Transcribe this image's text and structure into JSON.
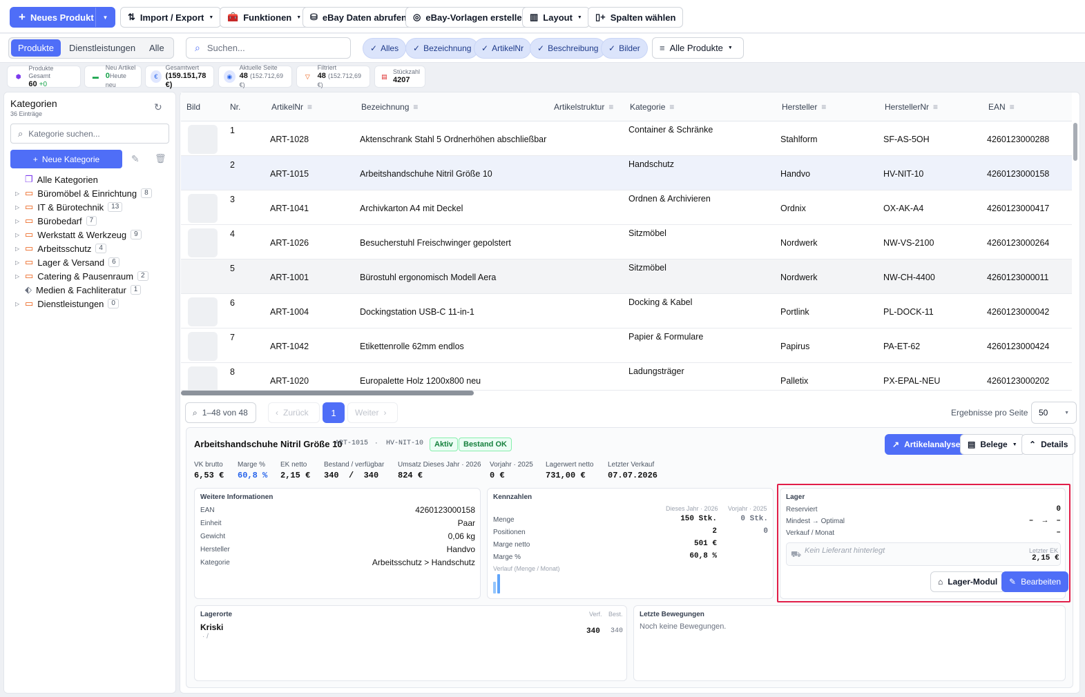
{
  "toolbar": {
    "new_product": "Neues Produkt",
    "import_export": "Import / Export",
    "functions": "Funktionen",
    "ebay_fetch": "eBay Daten abrufen",
    "ebay_templates": "eBay-Vorlagen erstellen",
    "layout": "Layout",
    "columns": "Spalten wählen"
  },
  "tabs": [
    "Produkte",
    "Dienstleistungen",
    "Alle"
  ],
  "search": {
    "placeholder": "Suchen..."
  },
  "filters": [
    "Alles",
    "Bezeichnung",
    "ArtikelNr",
    "Beschreibung",
    "Bilder"
  ],
  "product_filter": "Alle Produkte",
  "stats": [
    {
      "label": "Produkte Gesamt",
      "value": "60",
      "extra": "+0"
    },
    {
      "label": "Neu Artikel",
      "value": "0",
      "extra": "Heute neu"
    },
    {
      "label": "Gesamtwert",
      "value": "(159.151,78 €)",
      "extra": ""
    },
    {
      "label": "Aktuelle Seite",
      "value": "48",
      "extra": "(152.712,69 €)"
    },
    {
      "label": "Filtriert",
      "value": "48",
      "extra": "(152.712,69 €)"
    },
    {
      "label": "Stückzahl",
      "value": "4207",
      "extra": ""
    }
  ],
  "sidebar": {
    "title": "Kategorien",
    "subtitle": "36 Einträge",
    "search_placeholder": "Kategorie suchen...",
    "new_category": "Neue Kategorie",
    "all": "Alle Kategorien",
    "items": [
      {
        "label": "Büromöbel & Einrichtung",
        "count": "8"
      },
      {
        "label": "IT & Bürotechnik",
        "count": "13"
      },
      {
        "label": "Bürobedarf",
        "count": "7"
      },
      {
        "label": "Werkstatt & Werkzeug",
        "count": "9"
      },
      {
        "label": "Arbeitsschutz",
        "count": "4"
      },
      {
        "label": "Lager & Versand",
        "count": "6"
      },
      {
        "label": "Catering & Pausenraum",
        "count": "2"
      },
      {
        "label": "Medien & Fachliteratur",
        "count": "1"
      },
      {
        "label": "Dienstleistungen",
        "count": "0"
      }
    ]
  },
  "table": {
    "headers": [
      "Bild",
      "Nr.",
      "ArtikelNr",
      "Bezeichnung",
      "Artikelstruktur",
      "Kategorie",
      "Hersteller",
      "HerstellerNr",
      "EAN"
    ],
    "rows": [
      {
        "nr": "1",
        "art": "ART-1028",
        "bez": "Aktenschrank Stahl 5 Ordnerhöhen abschließbar",
        "kat": "Container & Schränke",
        "her": "Stahlform",
        "hnr": "SF-AS-5OH",
        "ean": "4260123000288"
      },
      {
        "nr": "2",
        "art": "ART-1015",
        "bez": "Arbeitshandschuhe Nitril Größe 10",
        "kat": "Handschutz",
        "her": "Handvo",
        "hnr": "HV-NIT-10",
        "ean": "4260123000158"
      },
      {
        "nr": "3",
        "art": "ART-1041",
        "bez": "Archivkarton A4 mit Deckel",
        "kat": "Ordnen & Archivieren",
        "her": "Ordnix",
        "hnr": "OX-AK-A4",
        "ean": "4260123000417"
      },
      {
        "nr": "4",
        "art": "ART-1026",
        "bez": "Besucherstuhl Freischwinger gepolstert",
        "kat": "Sitzmöbel",
        "her": "Nordwerk",
        "hnr": "NW-VS-2100",
        "ean": "4260123000264"
      },
      {
        "nr": "5",
        "art": "ART-1001",
        "bez": "Bürostuhl ergonomisch Modell Aera",
        "kat": "Sitzmöbel",
        "her": "Nordwerk",
        "hnr": "NW-CH-4400",
        "ean": "4260123000011"
      },
      {
        "nr": "6",
        "art": "ART-1004",
        "bez": "Dockingstation USB-C 11-in-1",
        "kat": "Docking & Kabel",
        "her": "Portlink",
        "hnr": "PL-DOCK-11",
        "ean": "4260123000042"
      },
      {
        "nr": "7",
        "art": "ART-1042",
        "bez": "Etikettenrolle 62mm endlos",
        "kat": "Papier & Formulare",
        "her": "Papirus",
        "hnr": "PA-ET-62",
        "ean": "4260123000424"
      },
      {
        "nr": "8",
        "art": "ART-1020",
        "bez": "Europalette Holz 1200x800 neu",
        "kat": "Ladungsträger",
        "her": "Palletix",
        "hnr": "PX-EPAL-NEU",
        "ean": "4260123000202"
      }
    ]
  },
  "pagination": {
    "range": "1–48 von 48",
    "prev": "Zurück",
    "page": "1",
    "next": "Weiter",
    "per_page_label": "Ergebnisse pro Seite",
    "per_page": "50"
  },
  "detail": {
    "title": "Arbeitshandschuhe Nitril Größe 10",
    "art": "ART-1015",
    "dot": "·",
    "hnr": "HV-NIT-10",
    "badge_active": "Aktiv",
    "badge_stock": "Bestand OK",
    "btn_analysis": "Artikelanalyse",
    "btn_docs": "Belege",
    "btn_details": "Details",
    "metrics": [
      {
        "label": "VK brutto",
        "value": "6,53 €"
      },
      {
        "label": "Marge %",
        "value": "60,8 %"
      },
      {
        "label": "EK netto",
        "value": "2,15 €"
      },
      {
        "label": "Bestand / verfügbar",
        "value": "340  /  340"
      },
      {
        "label": "Umsatz Dieses Jahr · 2026",
        "value": "824 €"
      },
      {
        "label": "Vorjahr · 2025",
        "value": "0 €"
      },
      {
        "label": "Lagerwert netto",
        "value": "731,00 €"
      },
      {
        "label": "Letzter Verkauf",
        "value": "07.07.2026"
      }
    ],
    "info": {
      "title": "Weitere Informationen",
      "rows": [
        {
          "k": "EAN",
          "v": "4260123000158"
        },
        {
          "k": "Einheit",
          "v": "Paar"
        },
        {
          "k": "Gewicht",
          "v": "0,06 kg"
        },
        {
          "k": "Hersteller",
          "v": "Handvo"
        },
        {
          "k": "Kategorie",
          "v": "Arbeitsschutz > Handschutz"
        }
      ]
    },
    "kpi": {
      "title": "Kennzahlen",
      "col1": "Dieses Jahr · 2026",
      "col2": "Vorjahr · 2025",
      "rows": [
        {
          "k": "Menge",
          "a": "150 Stk.",
          "b": "0 Stk."
        },
        {
          "k": "Positionen",
          "a": "2",
          "b": "0"
        },
        {
          "k": "Marge netto",
          "a": "501 €",
          "b": ""
        },
        {
          "k": "Marge %",
          "a": "60,8 %",
          "b": ""
        }
      ],
      "trend_label": "Verlauf (Menge / Monat)",
      "trend": [
        0.6,
        1.0
      ]
    },
    "lager": {
      "title": "Lager",
      "rows": [
        {
          "k": "Reserviert",
          "v": "0"
        },
        {
          "k": "Mindest → Optimal",
          "v": "–  →  –"
        },
        {
          "k": "Verkauf / Monat",
          "v": "–"
        }
      ],
      "supplier": "Kein Lieferant hinterlegt",
      "last_ek_label": "Letzter EK",
      "last_ek": "2,15 €",
      "btn_module": "Lager-Modul",
      "btn_edit": "Bearbeiten"
    },
    "locations": {
      "title": "Lagerorte",
      "col1": "Verf.",
      "col2": "Best.",
      "name": "Kriski",
      "sub": "·  /",
      "v1": "340",
      "v2": "340"
    },
    "moves": {
      "title": "Letzte Bewegungen",
      "empty": "Noch keine Bewegungen."
    }
  },
  "colors": {
    "primary": "#4f6ef7",
    "highlight": "#e11d48"
  }
}
